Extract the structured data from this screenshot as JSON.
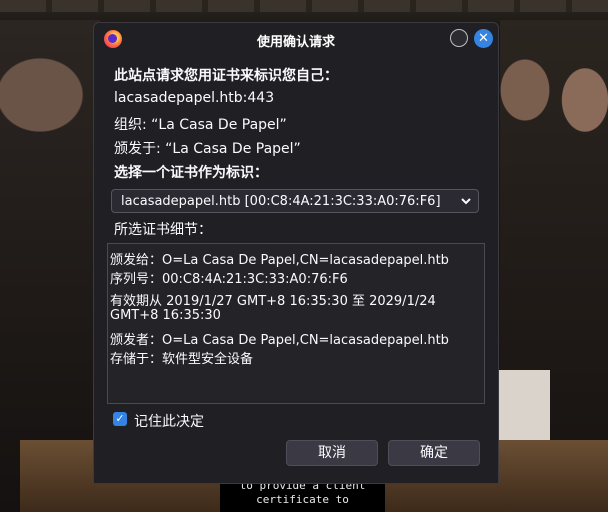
{
  "background": {
    "caption_line1": "to provide a client",
    "caption_line2": "certificate to"
  },
  "dialog": {
    "title": "使用确认请求",
    "app_icon": "firefox-icon",
    "close_glyph": "✕",
    "intro": "此站点请求您用证书来标识您自己：",
    "host": "lacasadepapel.htb:443",
    "organization": "组织: “La Casa De Papel”",
    "issued_under": "颁发于: “La Casa De Papel”",
    "choose_label": "选择一个证书作为标识：",
    "selected_certificate": "lacasadepapel.htb [00:C8:4A:21:3C:33:A0:76:F6]",
    "details_label": "所选证书细节：",
    "details": [
      "颁发给：O=La Casa De Papel,CN=lacasadepapel.htb",
      "序列号：00:C8:4A:21:3C:33:A0:76:F6",
      "有效期从 2019/1/27 GMT+8 16:35:30 至 2029/1/24",
      "GMT+8 16:35:30",
      "颁发者：O=La Casa De Papel,CN=lacasadepapel.htb",
      "存储于：软件型安全设备"
    ],
    "remember_label": "记住此决定",
    "remember_checked": true,
    "check_glyph": "✓",
    "cancel_label": "取消",
    "ok_label": "确定",
    "accent_color": "#3584e4"
  }
}
